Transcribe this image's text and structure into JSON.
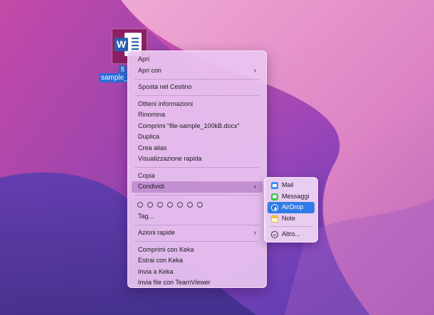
{
  "desktop": {
    "file": {
      "icon_badge": "W",
      "label_line1": "fi",
      "label_line2": "sample_"
    }
  },
  "context_menu": {
    "group1": [
      {
        "label": "Apri",
        "submenu": false
      },
      {
        "label": "Apri con",
        "submenu": true
      }
    ],
    "group2": [
      {
        "label": "Sposta nel Cestino",
        "submenu": false
      }
    ],
    "group3": [
      {
        "label": "Ottieni informazioni",
        "submenu": false
      },
      {
        "label": "Rinomina",
        "submenu": false
      },
      {
        "label": "Comprimi “file-sample_100kB.docx”",
        "submenu": false
      },
      {
        "label": "Duplica",
        "submenu": false
      },
      {
        "label": "Crea alias",
        "submenu": false
      },
      {
        "label": "Visualizzazione rapida",
        "submenu": false
      }
    ],
    "group4": [
      {
        "label": "Copia",
        "submenu": false
      },
      {
        "label": "Condividi",
        "submenu": true,
        "highlighted": true
      }
    ],
    "tags_label": "Tag...",
    "tag_dot_count": 7,
    "group5": [
      {
        "label": "Azioni rapide",
        "submenu": true
      }
    ],
    "group6": [
      {
        "label": "Comprimi con Keka",
        "submenu": false
      },
      {
        "label": "Estrai con Keka",
        "submenu": false
      },
      {
        "label": "Invia a Keka",
        "submenu": false
      },
      {
        "label": "Invia file con TeamViewer",
        "submenu": false
      }
    ],
    "chevron": "›"
  },
  "share_submenu": {
    "items": [
      {
        "label": "Mail",
        "icon": "mail-icon"
      },
      {
        "label": "Messaggi",
        "icon": "messages-icon"
      },
      {
        "label": "AirDrop",
        "icon": "airdrop-icon",
        "selected": true
      },
      {
        "label": "Note",
        "icon": "notes-icon"
      }
    ],
    "more": {
      "label": "Altro...",
      "icon": "more-icon"
    }
  },
  "colors": {
    "selection": "#2f7ce6",
    "word_blue": "#2b5fb3"
  }
}
